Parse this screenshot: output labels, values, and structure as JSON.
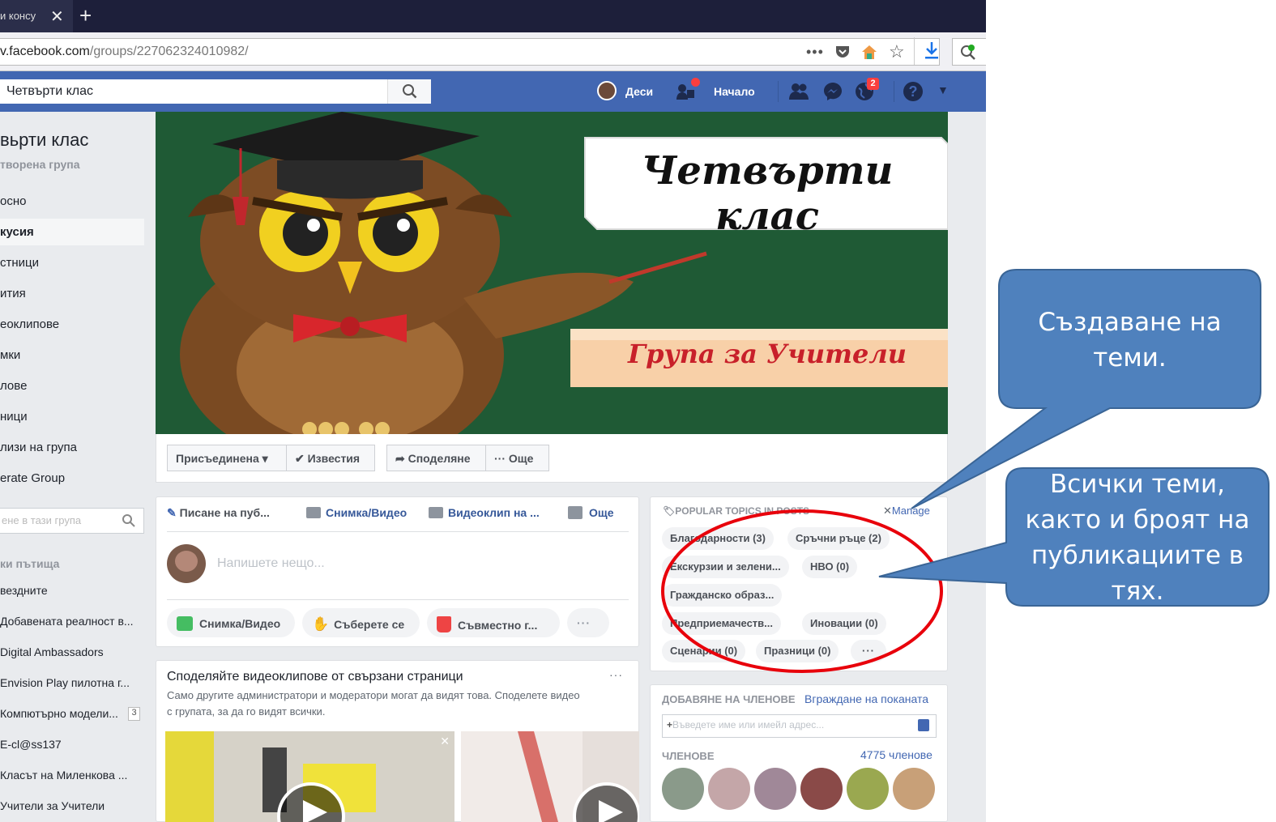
{
  "browser": {
    "tab_title": "и консу",
    "url_main": "v.facebook.com",
    "url_path": "/groups/227062324010982/"
  },
  "fb": {
    "search_value": "Четвърти клас",
    "user_name": "Деси",
    "home": "Начало",
    "notif_count": "2"
  },
  "group": {
    "name": "вьрти клас",
    "type": "творена група"
  },
  "left_nav": [
    "осно",
    "кусия",
    "стници",
    "ития",
    "еоклипове",
    "мки",
    "лове",
    "ници",
    "лизи на група",
    "erate Group"
  ],
  "left_search_placeholder": "ене в тази група",
  "shortcuts": {
    "title": "ки пътища",
    "items": [
      "вездните",
      "Добавената реалност в...",
      "Digital Ambassadors",
      "Envision Play пилотна г...",
      "Компютърно модели...",
      "E-cl@ss137",
      "Класът на Миленкова ...",
      "Учители за Учители"
    ],
    "badge": "3"
  },
  "cover": {
    "title": "Четвърти клас",
    "subtitle": "Група за Учители"
  },
  "actions": {
    "joined": "Присъединена ▾",
    "notifications": "✔ Известия",
    "share": "➦ Споделяне",
    "more": "··· Още"
  },
  "composer": {
    "tab_write": "Писане на пуб...",
    "tab_photo": "Снимка/Видео",
    "tab_video": "Видеоклип на ...",
    "tab_more": "Още",
    "placeholder": "Напишете нещо...",
    "pill_photo": "Снимка/Видео",
    "pill_gather": "Съберете се",
    "pill_joint": "Съвместно г...",
    "pill_more": "···"
  },
  "videos": {
    "title": "Споделяйте видеоклипове от свързани страници",
    "desc1": "Само другите администратори и модератори могат да видят това. Споделете видео",
    "desc2": "с групата, за да го видят всички."
  },
  "topics": {
    "header": "POPULAR TOPICS IN POSTS",
    "manage": "Manage",
    "items": [
      "Благодарности (3)",
      "Сръчни ръце (2)",
      "Екскурзии и зелени...",
      "НВО (0)",
      "Гражданско образ...",
      "Предприемачеств...",
      "Иновации (0)",
      "Сценарии (0)",
      "Празници (0)",
      "···"
    ]
  },
  "members": {
    "add_title": "ДОБАВЯНЕ НА ЧЛЕНОВЕ",
    "embed": "Вграждане на поканата",
    "input_placeholder": "Въведете име или имейл адрес...",
    "title": "ЧЛЕНОВЕ",
    "count": "4775 членове"
  },
  "callouts": {
    "top": [
      "Създаване на",
      "теми."
    ],
    "bottom": [
      "Всички теми,",
      "както и броят на",
      "публикациите в",
      "тях."
    ]
  },
  "colors": {
    "fb_blue": "#4267b2",
    "callout_fill": "#4f81bd",
    "callout_border": "#3a6596",
    "ellipse": "#e8000b"
  }
}
